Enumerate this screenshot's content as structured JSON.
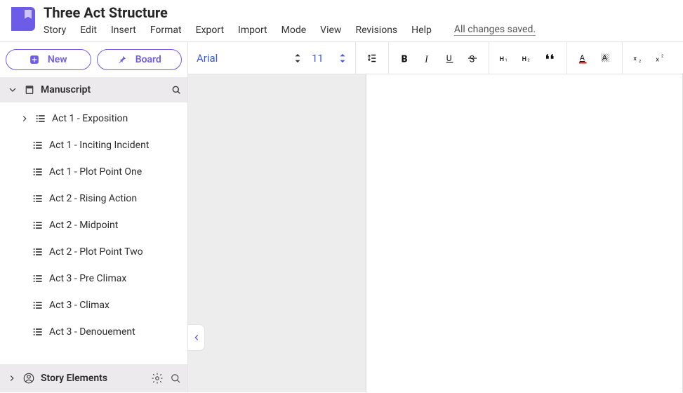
{
  "header": {
    "title": "Three Act Structure",
    "menu": [
      "Story",
      "Edit",
      "Insert",
      "Format",
      "Export",
      "Import",
      "Mode",
      "View",
      "Revisions",
      "Help"
    ],
    "save_status": "All changes saved."
  },
  "sidebar": {
    "new_label": "New",
    "board_label": "Board",
    "manuscript": {
      "label": "Manuscript",
      "items": [
        {
          "label": "Act 1 - Exposition",
          "expandable": true
        },
        {
          "label": "Act 1 - Inciting Incident",
          "expandable": false
        },
        {
          "label": "Act 1 - Plot Point One",
          "expandable": false
        },
        {
          "label": "Act 2 - Rising Action",
          "expandable": false
        },
        {
          "label": "Act 2 - Midpoint",
          "expandable": false
        },
        {
          "label": "Act 2 - Plot Point Two",
          "expandable": false
        },
        {
          "label": "Act 3 - Pre Climax",
          "expandable": false
        },
        {
          "label": "Act 3 - Climax",
          "expandable": false
        },
        {
          "label": "Act 3 - Denouement",
          "expandable": false
        }
      ]
    },
    "story_elements_label": "Story Elements"
  },
  "toolbar": {
    "font": "Arial",
    "size": "11"
  }
}
